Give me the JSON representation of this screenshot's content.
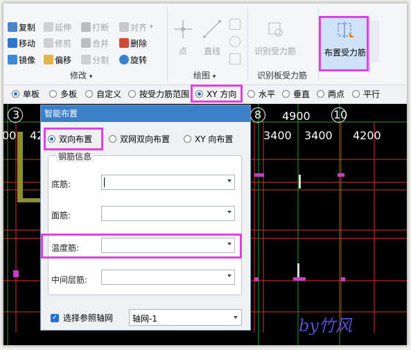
{
  "ribbon": {
    "modify": {
      "items": [
        "复制",
        "移动",
        "镜像",
        "延伸",
        "修剪",
        "偏移",
        "打断",
        "合并",
        "分割",
        "对齐",
        "删除",
        "旋转"
      ],
      "group_label": "修改"
    },
    "draw": {
      "items": [
        "点",
        "直线"
      ],
      "group_label": "绘图"
    },
    "identify": {
      "item": "识别受力筋",
      "group_label": "识别板受力筋"
    },
    "place": {
      "item": "布置受力筋"
    }
  },
  "options_bar": {
    "items": [
      "单板",
      "多板",
      "自定义",
      "按受力筋范围",
      "XY 方向",
      "水平",
      "垂直",
      "两点",
      "平行"
    ],
    "selected": "XY 方向"
  },
  "canvas": {
    "labels": [
      "3",
      "8",
      "4900",
      "10",
      "00",
      "42",
      "3400",
      "3400",
      "4200"
    ],
    "watermark": "by竹风"
  },
  "dialog": {
    "title": "智能布置",
    "layout_options": [
      "双向布置",
      "双网双向布置",
      "XY 向布置"
    ],
    "selected_layout": "双向布置",
    "group_title": "钢筋信息",
    "fields": [
      {
        "label": "底筋:",
        "value": ""
      },
      {
        "label": "面筋:",
        "value": ""
      },
      {
        "label": "温度筋:",
        "value": ""
      },
      {
        "label": "中间层筋:",
        "value": ""
      }
    ],
    "axis_checkbox_label": "选择参照轴网",
    "axis_checked": true,
    "axis_value": "轴网-1"
  }
}
